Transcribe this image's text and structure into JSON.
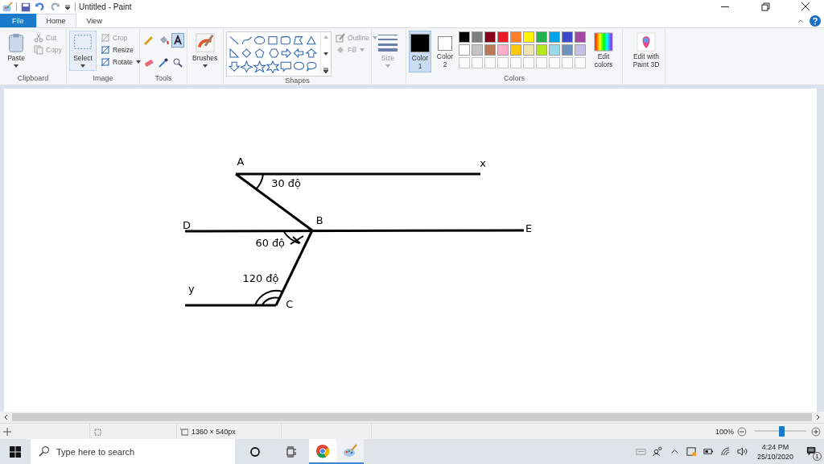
{
  "window": {
    "title": "Untitled - Paint"
  },
  "tabs": [
    {
      "label": "File",
      "kind": "file",
      "selected": false
    },
    {
      "label": "Home",
      "kind": "tab",
      "selected": true
    },
    {
      "label": "View",
      "kind": "tab",
      "selected": false
    }
  ],
  "clipboard": {
    "label": "Clipboard",
    "paste": "Paste",
    "items": [
      {
        "label": "Cut",
        "disabled": true
      },
      {
        "label": "Copy",
        "disabled": true
      }
    ]
  },
  "image": {
    "label": "Image",
    "select": "Select",
    "items": [
      {
        "label": "Crop",
        "disabled": true
      },
      {
        "label": "Resize",
        "disabled": false
      },
      {
        "label": "Rotate",
        "disabled": false
      }
    ]
  },
  "tools": {
    "label": "Tools",
    "items": [
      {
        "kind": "pencil",
        "selected": false
      },
      {
        "kind": "fill",
        "selected": false
      },
      {
        "kind": "text",
        "selected": true
      },
      {
        "kind": "eraser",
        "selected": false
      },
      {
        "kind": "picker",
        "selected": false
      },
      {
        "kind": "magnifier",
        "selected": false
      }
    ]
  },
  "brushes": {
    "label": "Brushes"
  },
  "shapes": {
    "label": "Shapes",
    "outline": {
      "label": "Outline",
      "disabled": true
    },
    "fill": {
      "label": "Fill",
      "disabled": true
    }
  },
  "size": {
    "label": "Size",
    "disabled": true
  },
  "colors": {
    "label": "Colors",
    "edit": "Edit colors",
    "slots": [
      {
        "label": "Color 1",
        "color": "#000000",
        "selected": true
      },
      {
        "label": "Color 2",
        "color": "#ffffff",
        "selected": false
      }
    ],
    "palette": [
      {
        "color": "#000000"
      },
      {
        "color": "#7f7f7f"
      },
      {
        "color": "#880015"
      },
      {
        "color": "#ed1c24"
      },
      {
        "color": "#ff7f27"
      },
      {
        "color": "#fff200"
      },
      {
        "color": "#22b14c"
      },
      {
        "color": "#00a2e8"
      },
      {
        "color": "#3f48cc"
      },
      {
        "color": "#a349a4"
      },
      {
        "color": "#ffffff"
      },
      {
        "color": "#c3c3c3"
      },
      {
        "color": "#b97a57"
      },
      {
        "color": "#ffaec9"
      },
      {
        "color": "#ffc90e"
      },
      {
        "color": "#efe4b0"
      },
      {
        "color": "#b5e61d"
      },
      {
        "color": "#99d9ea"
      },
      {
        "color": "#7092be"
      },
      {
        "color": "#c8bfe7"
      }
    ]
  },
  "paint3d": {
    "label": "Edit with Paint 3D"
  },
  "diagram": {
    "labels": [
      "A",
      "x",
      "30 độ",
      "D",
      "B",
      "E",
      "60 độ",
      "120 độ",
      "y",
      "C"
    ]
  },
  "status_bar": {
    "canvas_size": "1360 × 540px",
    "zoom": "100%",
    "level": 0.52
  },
  "taskbar": {
    "search": {
      "placeholder": "Type here to search"
    },
    "time": "4:24 PM",
    "date": "25/10/2020",
    "notifications": "1"
  }
}
